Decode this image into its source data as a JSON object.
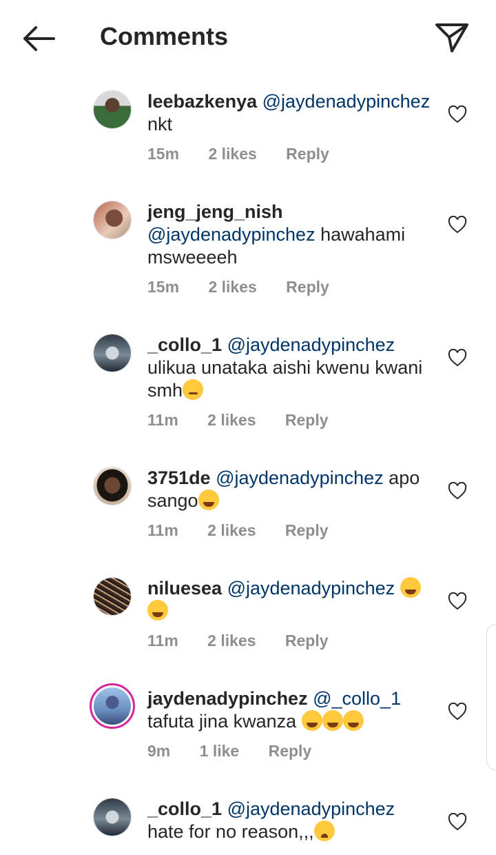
{
  "header": {
    "title": "Comments",
    "back_icon": "arrow-left-icon",
    "send_icon": "paper-plane-icon"
  },
  "colors": {
    "text": "#262626",
    "mention": "#003569",
    "meta": "#8e8e8e",
    "story_ring": "#d6249f"
  },
  "comments": [
    {
      "username": "leebazkenya",
      "mention": "@jaydenadypinchez",
      "text": " nkt",
      "emoji": "",
      "time": "15m",
      "likes": "2 likes",
      "reply": "Reply"
    },
    {
      "username": "jeng_jeng_nish",
      "mention": "@jaydenadypinchez",
      "text": " hawahami msweeeeh",
      "emoji": "",
      "time": "15m",
      "likes": "2 likes",
      "reply": "Reply"
    },
    {
      "username": "_collo_1",
      "mention": "@jaydenadypinchez",
      "text": " ulikua unataka aishi kwenu kwani smh",
      "emoji": "smirking-face",
      "time": "11m",
      "likes": "2 likes",
      "reply": "Reply"
    },
    {
      "username": "3751de",
      "mention": "@jaydenadypinchez",
      "text": "  apo sango",
      "emoji": "tears-of-joy",
      "time": "11m",
      "likes": "2 likes",
      "reply": "Reply"
    },
    {
      "username": "niluesea",
      "mention": "@jaydenadypinchez",
      "text": " ",
      "emoji": "tears-of-joy x2",
      "time": "11m",
      "likes": "2 likes",
      "reply": "Reply"
    },
    {
      "username": "jaydenadypinchez",
      "mention": "@_collo_1",
      "text": " tafuta jina kwanza ",
      "emoji": "tears-of-joy x3",
      "time": "9m",
      "likes": "1 like",
      "reply": "Reply"
    },
    {
      "username": "_collo_1",
      "mention": "@jaydenadypinchez",
      "text": " hate for no reason,,,",
      "emoji": "crying-face",
      "time": "",
      "likes": "",
      "reply": ""
    }
  ]
}
